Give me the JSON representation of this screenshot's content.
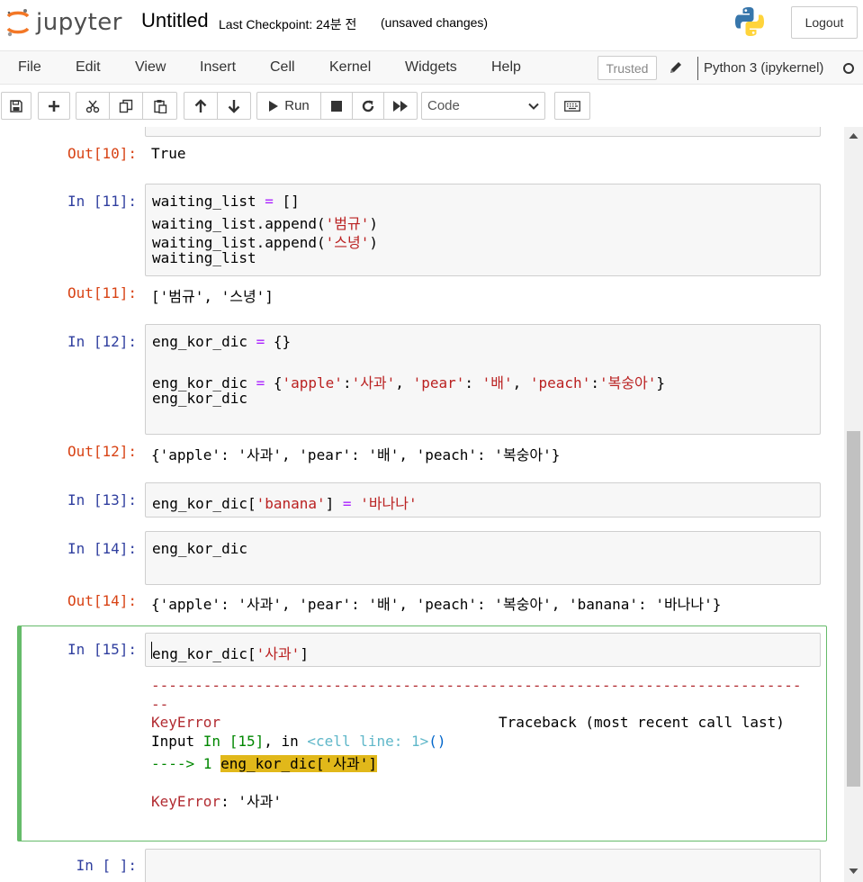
{
  "header": {
    "logo_text": "jupyter",
    "notebook_title": "Untitled",
    "checkpoint": "Last Checkpoint: 24분 전",
    "autosave_status": "(unsaved changes)",
    "logout_label": "Logout"
  },
  "menubar": {
    "items": [
      "File",
      "Edit",
      "View",
      "Insert",
      "Cell",
      "Kernel",
      "Widgets",
      "Help"
    ],
    "trusted_label": "Trusted",
    "kernel_name": "Python 3 (ipykernel)"
  },
  "toolbar": {
    "run_label": "Run",
    "cell_type": "Code",
    "icons": [
      "save-icon",
      "plus-icon",
      "cut-icon",
      "copy-icon",
      "paste-icon",
      "arrow-up-icon",
      "arrow-down-icon",
      "play-icon",
      "stop-icon",
      "restart-icon",
      "fast-forward-icon",
      "keyboard-icon"
    ]
  },
  "cells": {
    "out10": {
      "prompt": "Out[10]:",
      "text": "True"
    },
    "in11": {
      "prompt": "In [11]:",
      "lines": [
        "waiting_list = []",
        "waiting_list.append('범규')",
        "waiting_list.append('스녕')",
        "waiting_list"
      ]
    },
    "out11": {
      "prompt": "Out[11]:",
      "text": "['범규', '스녕']"
    },
    "in12": {
      "prompt": "In [12]:",
      "lines": [
        "eng_kor_dic = {}",
        "",
        "eng_kor_dic = {'apple':'사과', 'pear': '배', 'peach':'복숭아'}",
        "eng_kor_dic"
      ]
    },
    "out12": {
      "prompt": "Out[12]:",
      "text": "{'apple': '사과', 'pear': '배', 'peach': '복숭아'}"
    },
    "in13": {
      "prompt": "In [13]:",
      "lines": [
        "eng_kor_dic['banana'] = '바나나'"
      ]
    },
    "in14": {
      "prompt": "In [14]:",
      "lines": [
        "eng_kor_dic"
      ]
    },
    "out14": {
      "prompt": "Out[14]:",
      "text": "{'apple': '사과', 'pear': '배', 'peach': '복숭아', 'banana': '바나나'}"
    },
    "in15": {
      "prompt": "In [15]:",
      "lines": [
        "eng_kor_dic['사과']"
      ],
      "error": {
        "dashes_1": "---------------------------------------------------------------------------",
        "dashes_2": "--",
        "name": "KeyError",
        "traceback_label": "Traceback (most recent call last)",
        "input_prefix": "Input ",
        "input_in": "In [15]",
        "input_mid": ", in ",
        "input_cell": "<cell line: 1>",
        "input_paren": "()",
        "arrow": "----> 1 ",
        "highlight_code": "eng_kor_dic['사과']",
        "message_name": "KeyError",
        "message_value": ": '사과'"
      }
    },
    "in_empty": {
      "prompt": "In [ ]:"
    }
  }
}
